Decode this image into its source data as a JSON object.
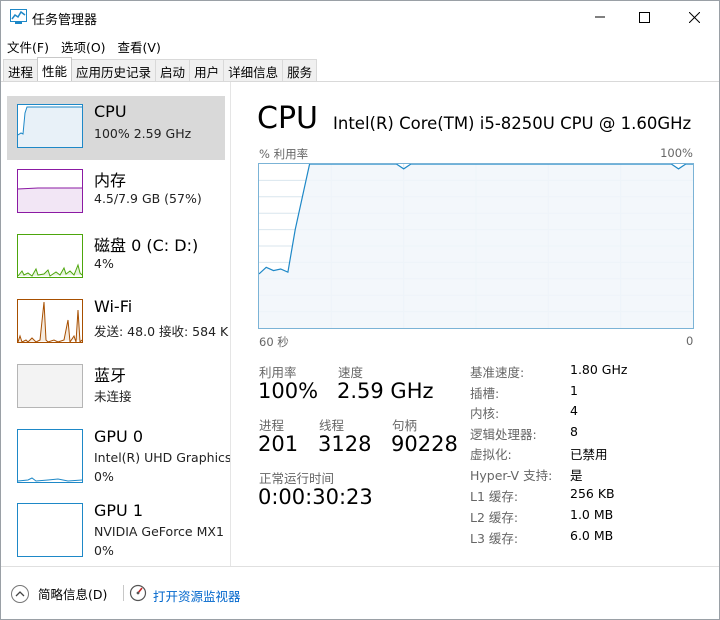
{
  "window": {
    "title": "任务管理器"
  },
  "menu": [
    "文件(F)",
    "选项(O)",
    "查看(V)"
  ],
  "tabs": [
    "进程",
    "性能",
    "应用历史记录",
    "启动",
    "用户",
    "详细信息",
    "服务"
  ],
  "active_tab": "性能",
  "resources": [
    {
      "name": "CPU",
      "sub": "100% 2.59 GHz",
      "color": "#1e88c7"
    },
    {
      "name": "内存",
      "sub": "4.5/7.9 GB (57%)",
      "color": "#8b1aa3"
    },
    {
      "name": "磁盘 0 (C: D:)",
      "sub": "4%",
      "color": "#4da60c"
    },
    {
      "name": "Wi-Fi",
      "sub": "发送: 48.0  接收: 584 K",
      "color": "#a74f00"
    },
    {
      "name": "蓝牙",
      "sub": "未连接",
      "color": "#999999"
    },
    {
      "name": "GPU 0",
      "sub": "Intel(R) UHD Graphics",
      "sub2": "0%",
      "color": "#1e88c7"
    },
    {
      "name": "GPU 1",
      "sub": "NVIDIA GeForce MX1",
      "sub2": "0%",
      "color": "#1e88c7"
    }
  ],
  "detail": {
    "title": "CPU",
    "model": "Intel(R) Core(TM) i5-8250U CPU @ 1.60GHz",
    "graph_label": "% 利用率",
    "graph_max": "100%",
    "graph_time": "60 秒",
    "graph_min": "0",
    "utilization_label": "利用率",
    "utilization": "100%",
    "speed_label": "速度",
    "speed": "2.59 GHz",
    "processes_label": "进程",
    "processes": "201",
    "threads_label": "线程",
    "threads": "3128",
    "handles_label": "句柄",
    "handles": "90228",
    "uptime_label": "正常运行时间",
    "uptime": "0:00:30:23",
    "specs": [
      {
        "label": "基准速度:",
        "value": "1.80 GHz"
      },
      {
        "label": "插槽:",
        "value": "1"
      },
      {
        "label": "内核:",
        "value": "4"
      },
      {
        "label": "逻辑处理器:",
        "value": "8"
      },
      {
        "label": "虚拟化:",
        "value": "已禁用"
      },
      {
        "label": "Hyper-V 支持:",
        "value": "是"
      },
      {
        "label": "L1 缓存:",
        "value": "256 KB"
      },
      {
        "label": "L2 缓存:",
        "value": "1.0 MB"
      },
      {
        "label": "L3 缓存:",
        "value": "6.0 MB"
      }
    ]
  },
  "footer": {
    "fewer_details": "简略信息(D)",
    "open_monitor": "打开资源监视器"
  },
  "colors": {
    "cpu_line": "#1e88c7",
    "cpu_fill": "#f1f6fa",
    "grid": "#d9e6ee",
    "link": "#0066cc"
  },
  "chart_data": {
    "type": "area",
    "x": [
      60,
      59,
      58,
      57,
      56,
      55,
      54,
      53,
      52,
      51,
      50,
      49,
      48,
      47,
      46,
      45,
      44,
      43,
      42,
      41,
      40,
      39,
      38,
      37,
      36,
      35,
      34,
      33,
      32,
      31,
      30,
      29,
      28,
      27,
      26,
      25,
      24,
      23,
      22,
      21,
      20,
      19,
      18,
      17,
      16,
      15,
      14,
      13,
      12,
      11,
      10,
      9,
      8,
      7,
      6,
      5,
      4,
      3,
      2,
      1,
      0
    ],
    "values": [
      33,
      37,
      35,
      36,
      34,
      60,
      80,
      100,
      100,
      100,
      100,
      100,
      100,
      100,
      100,
      100,
      100,
      100,
      100,
      100,
      97,
      100,
      100,
      100,
      100,
      100,
      100,
      100,
      100,
      100,
      100,
      100,
      100,
      100,
      100,
      100,
      100,
      100,
      100,
      100,
      100,
      100,
      100,
      100,
      100,
      100,
      100,
      100,
      100,
      100,
      100,
      100,
      100,
      100,
      100,
      100,
      100,
      100,
      97,
      100,
      100
    ],
    "xlim": [
      60,
      0
    ],
    "ylim": [
      0,
      100
    ],
    "grid": true
  }
}
